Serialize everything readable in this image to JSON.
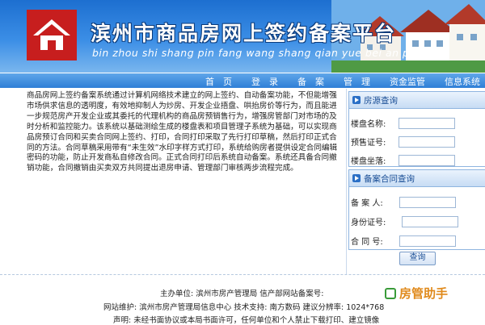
{
  "header": {
    "title": "滨州市商品房网上签约备案平台",
    "subtitle": "bin zhou shi shang pin fang wang shang qian yue bei an ping tai"
  },
  "nav": {
    "items": [
      "首　页",
      "登　录",
      "备　案",
      "管　理",
      "资金监管",
      "信息系统"
    ]
  },
  "intro": {
    "text": "商品房网上签约备案系统通过计算机网络技术建立的网上签约、自动备案功能，不但能增强市场供求信息的透明度，有效地抑制人为炒房、开发企业捂盘、哄抬房价等行为，而且能进一步规范房产开发企业或其委托的代理机构的商品房预销售行为，增强房管部门对市场的及时分析和监控能力。该系统以基础测绘生成的楼盘表和项目管理子系统为基础，可以实现商品房预订合同和买卖合同网上签约、打印，合同打印采取了先行打印草稿，然后打印正式合同的方法。合同草稿采用带有“未生效”水印字样方式打印，系统给购房者提供设定合同编辑密码的功能，防止开发商私自修改合同。正式合同打印后系统自动备案。系统还具备合同撤销功能，合同撤销由买卖双方共同提出退房申请、管理部门审核两步流程完成。"
  },
  "house_query": {
    "title": "房源查询",
    "fields": [
      {
        "label": "楼盘名称:",
        "value": ""
      },
      {
        "label": "预售证号:",
        "value": ""
      },
      {
        "label": "楼盘坐落:",
        "value": ""
      }
    ]
  },
  "contract_query": {
    "title": "备案合同查询",
    "fields": [
      {
        "label": "备 案 人:",
        "value": ""
      },
      {
        "label": "身份证号:",
        "value": ""
      },
      {
        "label": "合 同 号:",
        "value": ""
      }
    ],
    "button": "查询"
  },
  "footer": {
    "sponsor": "主办单位:  滨州市房产管理局  信产部网站备案号:",
    "maintainer": "网站维护:  滨州市房产管理局信息中心  技术支持:  南方数码  建议分辨率:  1024*768",
    "statement": "声明:  未经书面协议或本局书面许可，任何单位和个人禁止下载打印、建立镜像"
  },
  "helper": {
    "text": "房管助手"
  },
  "colors": {
    "nav": "#2f7fd6",
    "logo": "#c71e1e",
    "panel_border": "#8fb5e0"
  }
}
